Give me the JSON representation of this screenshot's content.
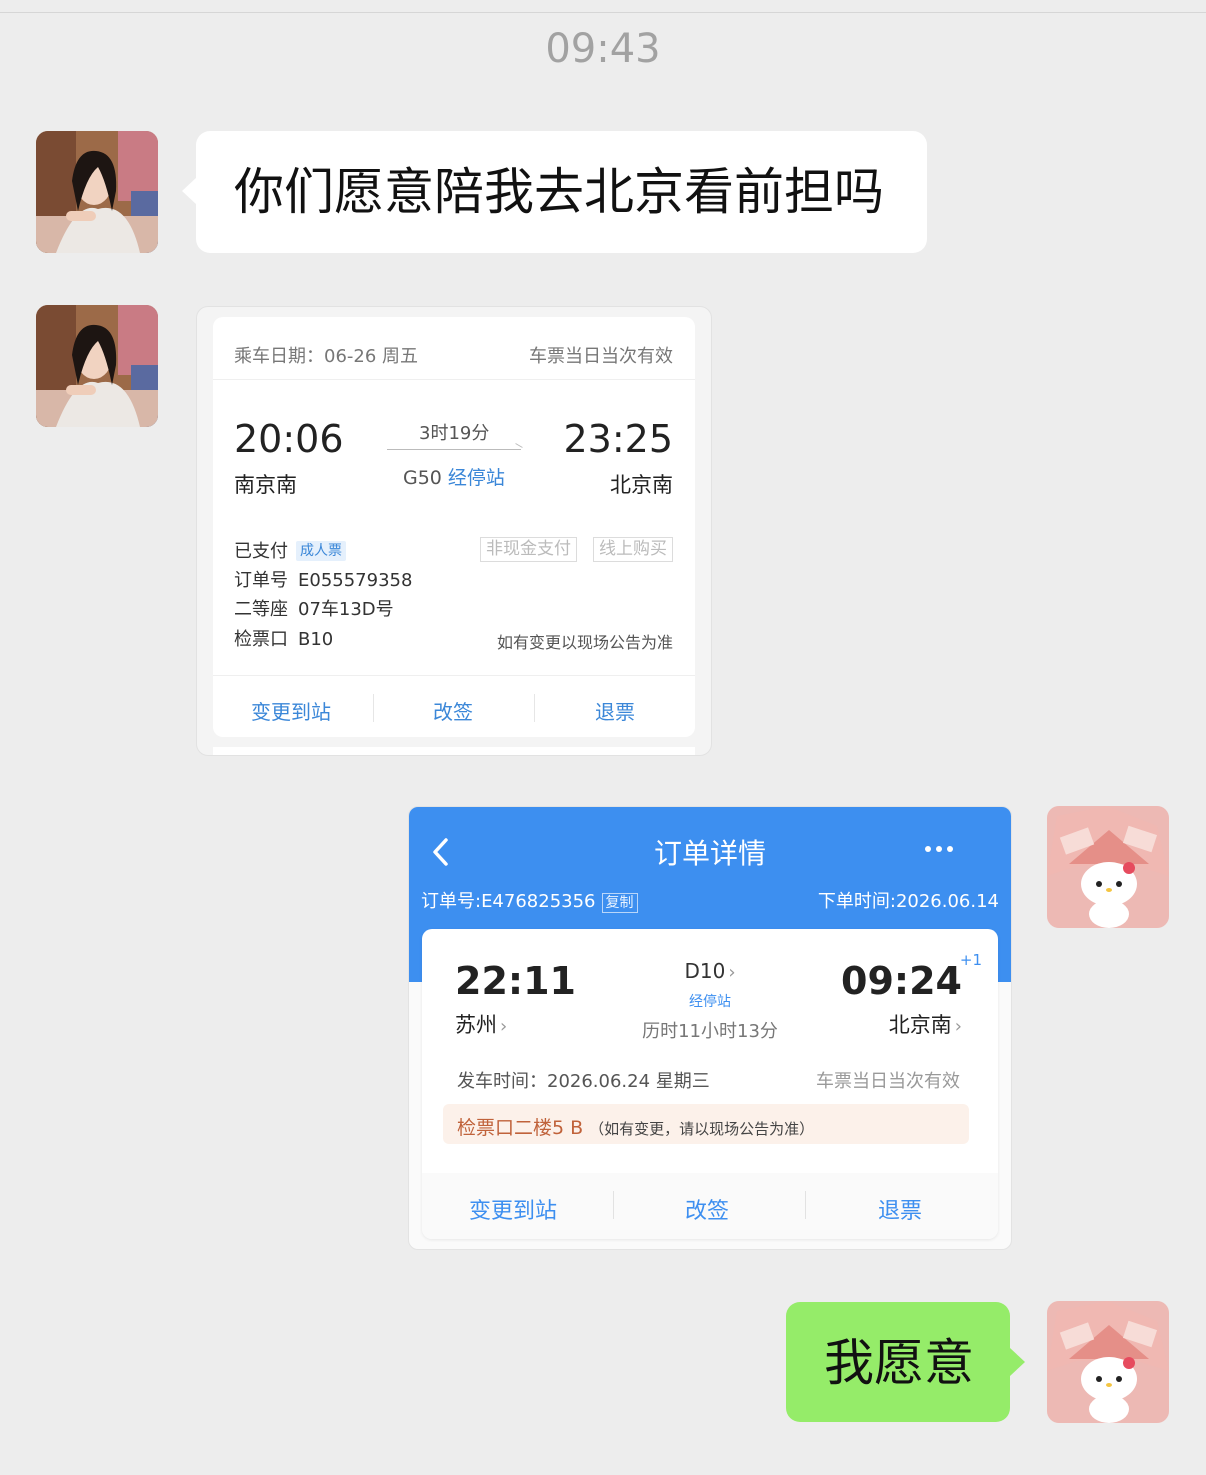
{
  "timestamp": "09:43",
  "messages": {
    "m1": {
      "sender": "friend",
      "text": "你们愿意陪我去北京看前担吗"
    },
    "m4": {
      "sender": "me",
      "text": "我愿意"
    }
  },
  "ticket1": {
    "travel_date": "乘车日期：06-26 周五",
    "validity": "车票当日当次有效",
    "departure_time": "20:06",
    "departure_station": "南京南",
    "duration": "3时19分",
    "train_no": "G50",
    "stops_link": "经停站",
    "arrival_time": "23:25",
    "arrival_station": "北京南",
    "paid_label": "已支付",
    "ticket_type": "成人票",
    "tag_noncash": "非现金支付",
    "tag_online": "线上购买",
    "order_label": "订单号",
    "order_no": "E055579358",
    "seat_class": "二等座",
    "seat_no": "07车13D号",
    "gate_label": "检票口",
    "gate": "B10",
    "notice": "如有变更以现场公告为准",
    "actions": [
      "变更到站",
      "改签",
      "退票"
    ]
  },
  "ticket2": {
    "page_title": "订单详情",
    "back_icon": "chevron-left-icon",
    "more_icon": "more-dots-icon",
    "order_no": "订单号:E476825356",
    "copy_label": "复制",
    "order_time": "下单时间:2026.06.14",
    "departure_time": "22:11",
    "departure_station": "苏州",
    "train_no": "D10",
    "stops_link": "经停站",
    "duration": "历时11小时13分",
    "arrival_time": "09:24",
    "next_day": "+1",
    "arrival_station": "北京南",
    "depart_date": "发车时间：2026.06.24 星期三",
    "validity": "车票当日当次有效",
    "gate": "检票口二楼5 B",
    "gate_note": "（如有变更，请以现场公告为准）",
    "actions": [
      "变更到站",
      "改签",
      "退票"
    ]
  },
  "colors": {
    "background": "#ededed",
    "bubble_green": "#95ec69",
    "header_blue": "#3d8ff0",
    "link_blue": "#3b87d8"
  }
}
